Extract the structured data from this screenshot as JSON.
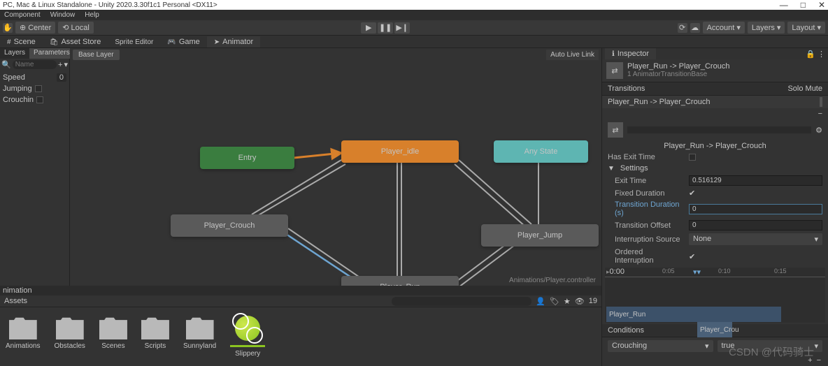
{
  "title": "PC, Mac & Linux Standalone - Unity 2020.3.30f1c1 Personal <DX11>",
  "win_ctrl": {
    "min": "—",
    "max": "□",
    "close": "✕"
  },
  "menu": [
    "Component",
    "Window",
    "Help"
  ],
  "toolbar": {
    "center": "Center",
    "local": "Local",
    "account": "Account",
    "layers": "Layers",
    "layout": "Layout"
  },
  "tabs": [
    "Scene",
    "Asset Store",
    "Sprite Editor",
    "Game",
    "Animator"
  ],
  "param_tabs": [
    "Layers",
    "Parameters"
  ],
  "search_placeholder": "Name",
  "params": {
    "speed": {
      "label": "Speed",
      "value": "0"
    },
    "jumping": {
      "label": "Jumping"
    },
    "crouching": {
      "label": "Crouchin"
    }
  },
  "crumb": "Base Layer",
  "autolink": "Auto Live Link",
  "nodes": {
    "entry": "Entry",
    "idle": "Player_idle",
    "any": "Any State",
    "crouch": "Player_Crouch",
    "run": "Player_Run",
    "jump": "Player_Jump"
  },
  "status": "Animations/Player.controller",
  "anim_tab": "nimation",
  "assets_label": "Assets",
  "assets_count": "19",
  "folders": [
    "Animations",
    "Obstacles",
    "Scenes",
    "Scripts",
    "Sunnyland",
    "Slippery"
  ],
  "inspector": {
    "title": "Inspector",
    "head1": "Player_Run -> Player_Crouch",
    "head2": "1 AnimatorTransitionBase",
    "trans_hdr": "Transitions",
    "solo": "Solo",
    "mute": "Mute",
    "trans_item": "Player_Run -> Player_Crouch",
    "trans_name": "Player_Run -> Player_Crouch",
    "props": {
      "has_exit": "Has Exit Time",
      "settings": "Settings",
      "exit_time": {
        "label": "Exit Time",
        "val": "0.516129"
      },
      "fixed_dur": {
        "label": "Fixed Duration"
      },
      "trans_dur": {
        "label": "Transition Duration (s)",
        "val": "0"
      },
      "trans_off": {
        "label": "Transition Offset",
        "val": "0"
      },
      "int_src": {
        "label": "Interruption Source",
        "val": "None"
      },
      "ord_int": {
        "label": "Ordered Interruption"
      }
    },
    "tl": {
      "t0": "0:00",
      "t1": "0:05",
      "t2": "0:10",
      "t3": "0:15",
      "bar1": "Player_Run",
      "bar2": "Player_Crou"
    },
    "conditions": "Conditions",
    "cond_param": "Crouching",
    "cond_val": "true"
  },
  "watermark": "CSDN @代码骑士"
}
